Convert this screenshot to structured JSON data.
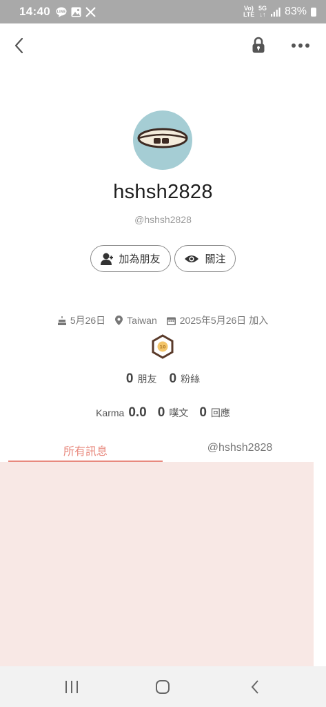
{
  "status_bar": {
    "time": "14:40",
    "notif_icons": [
      "line-icon",
      "gallery-icon",
      "x-icon"
    ],
    "volte_label": "Vo) LTE",
    "network_label": "5G",
    "battery": "83%"
  },
  "header": {
    "back_icon": "chevron-left-icon",
    "lock_icon": "lock-icon",
    "more_icon": "more-horizontal-icon"
  },
  "profile": {
    "display_name": "hshsh2828",
    "username": "@hshsh2828",
    "avatar_bg": "#a5cdd4"
  },
  "actions": {
    "add_friend_label": "加為朋友",
    "follow_label": "關注"
  },
  "meta": {
    "birthday": "5月26日",
    "location": "Taiwan",
    "joined": "2025年5月26日 加入"
  },
  "badge": {
    "label": "10"
  },
  "counts": {
    "friends_value": "0",
    "friends_label": "朋友",
    "fans_value": "0",
    "fans_label": "粉絲"
  },
  "stats": {
    "karma_label": "Karma",
    "karma_value": "0.0",
    "posts_value": "0",
    "posts_label": "噗文",
    "replies_value": "0",
    "replies_label": "回應"
  },
  "tabs": {
    "all_label": "所有訊息",
    "mentions_label": "@hshsh2828"
  },
  "colors": {
    "accent": "#e8897e",
    "panel_bg": "#f8e8e5",
    "status_bar_bg": "#a9a9a9"
  }
}
